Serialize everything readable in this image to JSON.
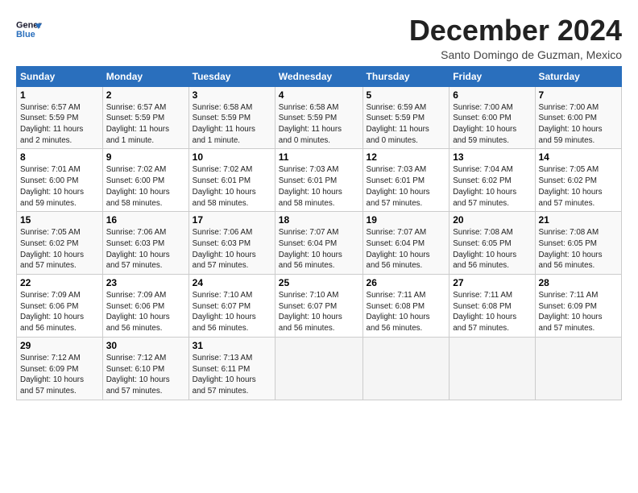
{
  "logo": {
    "line1": "General",
    "line2": "Blue"
  },
  "title": "December 2024",
  "location": "Santo Domingo de Guzman, Mexico",
  "header_days": [
    "Sunday",
    "Monday",
    "Tuesday",
    "Wednesday",
    "Thursday",
    "Friday",
    "Saturday"
  ],
  "weeks": [
    [
      {
        "day": "1",
        "info": "Sunrise: 6:57 AM\nSunset: 5:59 PM\nDaylight: 11 hours\nand 2 minutes."
      },
      {
        "day": "2",
        "info": "Sunrise: 6:57 AM\nSunset: 5:59 PM\nDaylight: 11 hours\nand 1 minute."
      },
      {
        "day": "3",
        "info": "Sunrise: 6:58 AM\nSunset: 5:59 PM\nDaylight: 11 hours\nand 1 minute."
      },
      {
        "day": "4",
        "info": "Sunrise: 6:58 AM\nSunset: 5:59 PM\nDaylight: 11 hours\nand 0 minutes."
      },
      {
        "day": "5",
        "info": "Sunrise: 6:59 AM\nSunset: 5:59 PM\nDaylight: 11 hours\nand 0 minutes."
      },
      {
        "day": "6",
        "info": "Sunrise: 7:00 AM\nSunset: 6:00 PM\nDaylight: 10 hours\nand 59 minutes."
      },
      {
        "day": "7",
        "info": "Sunrise: 7:00 AM\nSunset: 6:00 PM\nDaylight: 10 hours\nand 59 minutes."
      }
    ],
    [
      {
        "day": "8",
        "info": "Sunrise: 7:01 AM\nSunset: 6:00 PM\nDaylight: 10 hours\nand 59 minutes."
      },
      {
        "day": "9",
        "info": "Sunrise: 7:02 AM\nSunset: 6:00 PM\nDaylight: 10 hours\nand 58 minutes."
      },
      {
        "day": "10",
        "info": "Sunrise: 7:02 AM\nSunset: 6:01 PM\nDaylight: 10 hours\nand 58 minutes."
      },
      {
        "day": "11",
        "info": "Sunrise: 7:03 AM\nSunset: 6:01 PM\nDaylight: 10 hours\nand 58 minutes."
      },
      {
        "day": "12",
        "info": "Sunrise: 7:03 AM\nSunset: 6:01 PM\nDaylight: 10 hours\nand 57 minutes."
      },
      {
        "day": "13",
        "info": "Sunrise: 7:04 AM\nSunset: 6:02 PM\nDaylight: 10 hours\nand 57 minutes."
      },
      {
        "day": "14",
        "info": "Sunrise: 7:05 AM\nSunset: 6:02 PM\nDaylight: 10 hours\nand 57 minutes."
      }
    ],
    [
      {
        "day": "15",
        "info": "Sunrise: 7:05 AM\nSunset: 6:02 PM\nDaylight: 10 hours\nand 57 minutes."
      },
      {
        "day": "16",
        "info": "Sunrise: 7:06 AM\nSunset: 6:03 PM\nDaylight: 10 hours\nand 57 minutes."
      },
      {
        "day": "17",
        "info": "Sunrise: 7:06 AM\nSunset: 6:03 PM\nDaylight: 10 hours\nand 57 minutes."
      },
      {
        "day": "18",
        "info": "Sunrise: 7:07 AM\nSunset: 6:04 PM\nDaylight: 10 hours\nand 56 minutes."
      },
      {
        "day": "19",
        "info": "Sunrise: 7:07 AM\nSunset: 6:04 PM\nDaylight: 10 hours\nand 56 minutes."
      },
      {
        "day": "20",
        "info": "Sunrise: 7:08 AM\nSunset: 6:05 PM\nDaylight: 10 hours\nand 56 minutes."
      },
      {
        "day": "21",
        "info": "Sunrise: 7:08 AM\nSunset: 6:05 PM\nDaylight: 10 hours\nand 56 minutes."
      }
    ],
    [
      {
        "day": "22",
        "info": "Sunrise: 7:09 AM\nSunset: 6:06 PM\nDaylight: 10 hours\nand 56 minutes."
      },
      {
        "day": "23",
        "info": "Sunrise: 7:09 AM\nSunset: 6:06 PM\nDaylight: 10 hours\nand 56 minutes."
      },
      {
        "day": "24",
        "info": "Sunrise: 7:10 AM\nSunset: 6:07 PM\nDaylight: 10 hours\nand 56 minutes."
      },
      {
        "day": "25",
        "info": "Sunrise: 7:10 AM\nSunset: 6:07 PM\nDaylight: 10 hours\nand 56 minutes."
      },
      {
        "day": "26",
        "info": "Sunrise: 7:11 AM\nSunset: 6:08 PM\nDaylight: 10 hours\nand 56 minutes."
      },
      {
        "day": "27",
        "info": "Sunrise: 7:11 AM\nSunset: 6:08 PM\nDaylight: 10 hours\nand 57 minutes."
      },
      {
        "day": "28",
        "info": "Sunrise: 7:11 AM\nSunset: 6:09 PM\nDaylight: 10 hours\nand 57 minutes."
      }
    ],
    [
      {
        "day": "29",
        "info": "Sunrise: 7:12 AM\nSunset: 6:09 PM\nDaylight: 10 hours\nand 57 minutes."
      },
      {
        "day": "30",
        "info": "Sunrise: 7:12 AM\nSunset: 6:10 PM\nDaylight: 10 hours\nand 57 minutes."
      },
      {
        "day": "31",
        "info": "Sunrise: 7:13 AM\nSunset: 6:11 PM\nDaylight: 10 hours\nand 57 minutes."
      },
      null,
      null,
      null,
      null
    ]
  ]
}
